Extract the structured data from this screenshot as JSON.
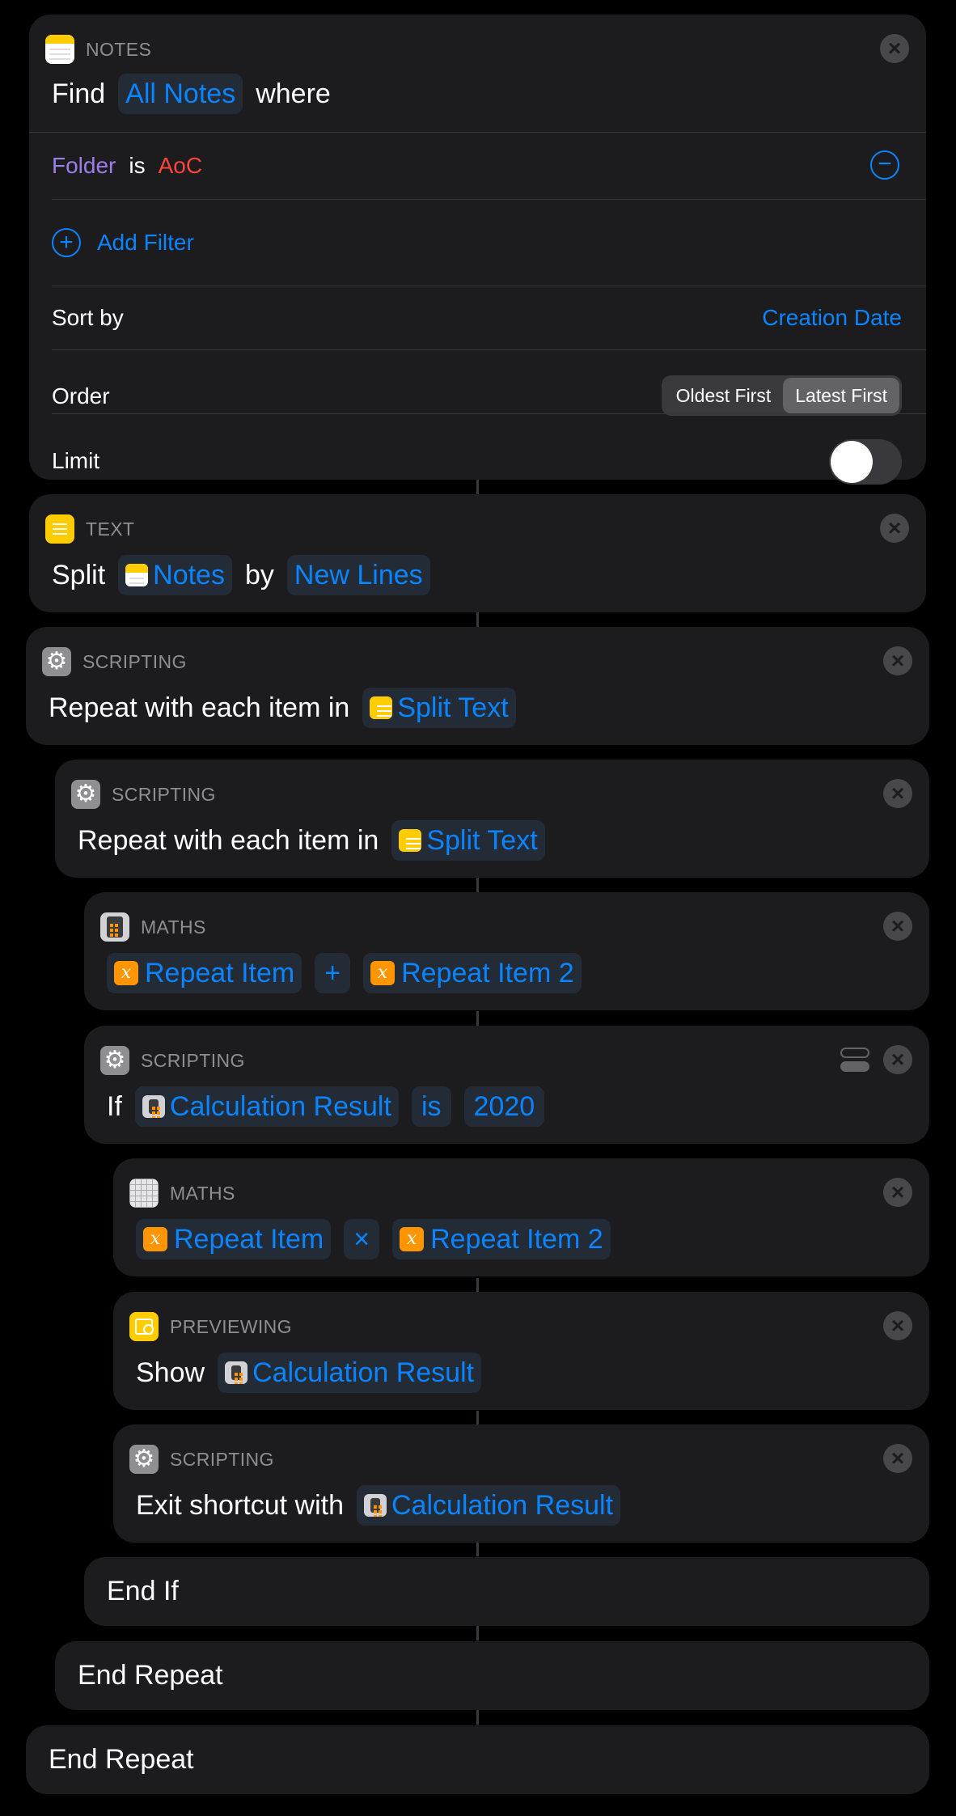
{
  "find_notes": {
    "category": "NOTES",
    "find_label": "Find",
    "source_token": "All Notes",
    "where_label": "where",
    "filter": {
      "field": "Folder",
      "operator": "is",
      "value": "AoC"
    },
    "add_filter_label": "Add Filter",
    "sort_label": "Sort by",
    "sort_value": "Creation Date",
    "order_label": "Order",
    "order_options": [
      "Oldest First",
      "Latest First"
    ],
    "order_selected": "Latest First",
    "limit_label": "Limit",
    "limit_enabled": false
  },
  "split_text": {
    "category": "TEXT",
    "verb": "Split",
    "input_token": "Notes",
    "by_label": "by",
    "separator_token": "New Lines"
  },
  "repeat_outer": {
    "category": "SCRIPTING",
    "label": "Repeat with each item in",
    "token": "Split Text"
  },
  "repeat_inner": {
    "category": "SCRIPTING",
    "label": "Repeat with each item in",
    "token": "Split Text"
  },
  "math_add": {
    "category": "MATHS",
    "left": "Repeat Item",
    "op": "+",
    "right": "Repeat Item 2"
  },
  "if_block": {
    "category": "SCRIPTING",
    "if_label": "If",
    "subject": "Calculation Result",
    "condition": "is",
    "value": "2020"
  },
  "math_multiply": {
    "category": "MATHS",
    "left": "Repeat Item",
    "op": "×",
    "right": "Repeat Item 2"
  },
  "show_result": {
    "category": "PREVIEWING",
    "label": "Show",
    "token": "Calculation Result"
  },
  "exit_shortcut": {
    "category": "SCRIPTING",
    "label": "Exit shortcut with",
    "token": "Calculation Result"
  },
  "end_if": {
    "label": "End If"
  },
  "end_repeat_inner": {
    "label": "End Repeat"
  },
  "end_repeat_outer": {
    "label": "End Repeat"
  },
  "icons": {
    "close": "×",
    "gear": "⚙",
    "variable": "x",
    "minus": "−",
    "plus": "+"
  },
  "colors": {
    "accent_blue": "#0a84ff",
    "filter_field_purple": "#a07ce6",
    "filter_value_red": "#ff453a",
    "variable_orange": "#ff9500",
    "notes_yellow": "#ffcc00",
    "card_bg": "#1c1c1e"
  }
}
